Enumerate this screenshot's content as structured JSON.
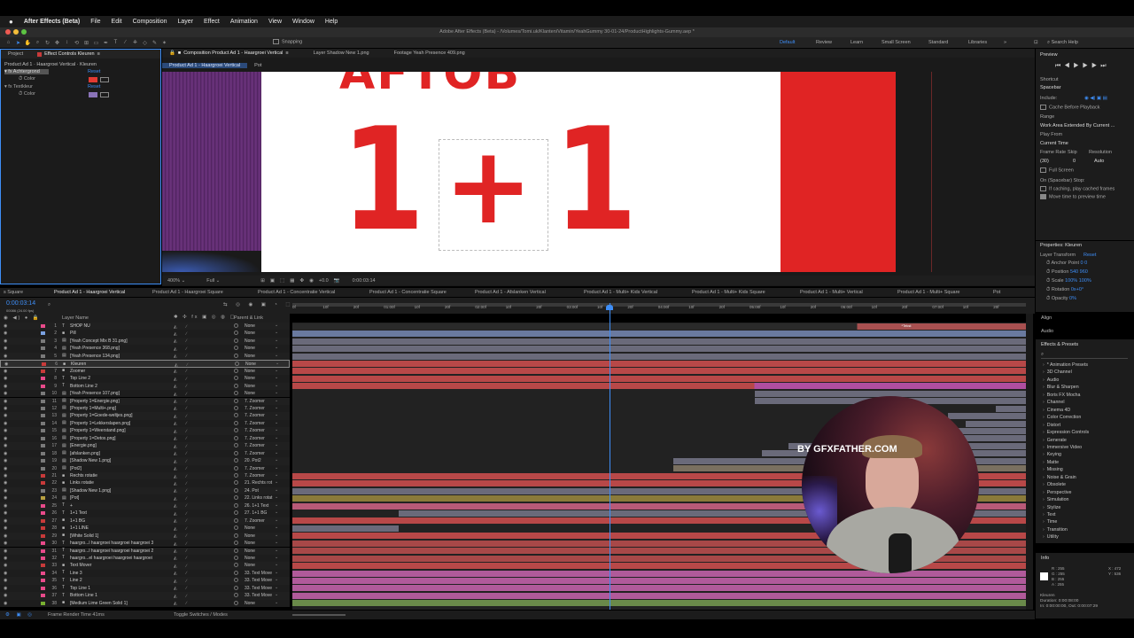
{
  "menubar": {
    "app": "After Effects (Beta)",
    "items": [
      "File",
      "Edit",
      "Composition",
      "Layer",
      "Effect",
      "Animation",
      "View",
      "Window",
      "Help"
    ]
  },
  "title": "Adobe After Effects (Beta) - /Volumes/Tomi.uk/Klanten/Vitamin/YeahGummy 30-01-24/ProductHighlights-Gummy.aep *",
  "toolbar": {
    "snapping": "Snapping",
    "workspaces": [
      "Default",
      "Review",
      "Learn",
      "Small Screen",
      "Standard",
      "Libraries"
    ],
    "search": "Search Help"
  },
  "project": {
    "tabs": [
      "Project",
      "Effect Controls Kleuren"
    ],
    "header": "Product Ad 1 · Haargroei Vertical · Kleuren",
    "effects": [
      {
        "name": "Achtergrond",
        "reset": "Reset",
        "prop": "Color",
        "color": "#e23a32"
      },
      {
        "name": "Textkleur",
        "reset": "Reset",
        "prop": "Color",
        "color": "#8a73b8"
      }
    ]
  },
  "viewer": {
    "tabs": [
      "Composition Product Ad 1 - Haargroei Vertical",
      "Layer Shadow New 1.png",
      "Footage Yeah Presence 409.png"
    ],
    "breadcrumb": [
      "Product Ad 1 - Haargroei Vertical",
      "Pot"
    ],
    "top_text": "AFTOB",
    "big_left": "1",
    "plus": "+",
    "big_right": "1",
    "zoom": "400%",
    "quality": "Full",
    "timecode": "0:00:03:14",
    "exposure": "+0.0"
  },
  "comp_tabs": [
    "s Square",
    "Product Ad 1 - Haargroei Vertical",
    "Product Ad 1 - Haargroei Square",
    "Product Ad 1 - Concentratie Vertical",
    "Product Ad 1 - Concentratie Square",
    "Product Ad 1 - Afslanken Vertical",
    "Product Ad 1 - Multi+ Kids Vertical",
    "Product Ad 1 - Multi+ Kids Square",
    "Product Ad 1 - Multi+ Vertical",
    "Product Ad 1 - Multi+ Square",
    "Pot"
  ],
  "timeline": {
    "timecode": "0:00:03:14",
    "frames": "00086 (24.00 fps)",
    "layer_name_header": "Layer Name",
    "parent_header": "Parent & Link",
    "ruler": [
      "0f",
      "10f",
      "20f",
      "01:00f",
      "10f",
      "20f",
      "02:00f",
      "10f",
      "20f",
      "03:00f",
      "10f",
      "20f",
      "04:00f",
      "10f",
      "20f",
      "05:00f",
      "10f",
      "20f",
      "06:00f",
      "10f",
      "20f",
      "07:00f",
      "10f",
      "20f"
    ],
    "marker": "*Tekst",
    "footer_left": "Frame Render Time 41ms",
    "footer_mid": "Toggle Switches / Modes"
  },
  "layers": [
    {
      "n": "1",
      "t": "T",
      "name": "SHOP NU",
      "parent": "None",
      "color": "#e84a8a"
    },
    {
      "n": "2",
      "t": "■",
      "name": "Pill",
      "parent": "None",
      "color": "#7aa0e0"
    },
    {
      "n": "3",
      "t": "▤",
      "name": "[Yeah Concept Mix B 31.png]",
      "parent": "None",
      "color": "#7a7a7a"
    },
    {
      "n": "4",
      "t": "▤",
      "name": "[Yeah Presence 368.png]",
      "parent": "None",
      "color": "#7a7a7a"
    },
    {
      "n": "5",
      "t": "▤",
      "name": "[Yeah Presence 134.png]",
      "parent": "None",
      "color": "#7a7a7a"
    },
    {
      "n": "6",
      "t": "■",
      "name": "Kleuren",
      "parent": "None",
      "color": "#c83a3a"
    },
    {
      "n": "7",
      "t": "■",
      "name": "Zoomer",
      "parent": "None",
      "color": "#c83a3a"
    },
    {
      "n": "8",
      "t": "T",
      "name": "Top Line 2",
      "parent": "None",
      "color": "#e84a8a"
    },
    {
      "n": "9",
      "t": "T",
      "name": "Bottom Line 2",
      "parent": "None",
      "color": "#e84a8a"
    },
    {
      "n": "10",
      "t": "▤",
      "name": "[Yeah Presence 107.png]",
      "parent": "None",
      "color": "#7a7a7a"
    },
    {
      "n": "11",
      "t": "▤",
      "name": "[Property 1=Energie.png]",
      "parent": "7. Zoomer",
      "color": "#7a7a7a"
    },
    {
      "n": "12",
      "t": "▤",
      "name": "[Property 1=Multi+.png]",
      "parent": "7. Zoomer",
      "color": "#7a7a7a"
    },
    {
      "n": "13",
      "t": "▤",
      "name": "[Property 1=Goede-weltjes.png]",
      "parent": "7. Zoomer",
      "color": "#7a7a7a"
    },
    {
      "n": "14",
      "t": "▤",
      "name": "[Property 1=Lekkerslapen.png]",
      "parent": "7. Zoomer",
      "color": "#7a7a7a"
    },
    {
      "n": "15",
      "t": "▤",
      "name": "[Property 1=Weerstand.png]",
      "parent": "7. Zoomer",
      "color": "#7a7a7a"
    },
    {
      "n": "16",
      "t": "▤",
      "name": "[Property 1=Detox.png]",
      "parent": "7. Zoomer",
      "color": "#7a7a7a"
    },
    {
      "n": "17",
      "t": "▤",
      "name": "[Energie.png]",
      "parent": "7. Zoomer",
      "color": "#7a7a7a"
    },
    {
      "n": "18",
      "t": "▤",
      "name": "[afslanken.png]",
      "parent": "7. Zoomer",
      "color": "#7a7a7a"
    },
    {
      "n": "19",
      "t": "▤",
      "name": "[Shadow New 1.png]",
      "parent": "20. Pot2",
      "color": "#7a7a7a"
    },
    {
      "n": "20",
      "t": "▤",
      "name": "[Pot2]",
      "parent": "7. Zoomer",
      "color": "#7a7a7a"
    },
    {
      "n": "21",
      "t": "■",
      "name": "Rechts rotatie",
      "parent": "7. Zoomer",
      "color": "#c83a3a"
    },
    {
      "n": "22",
      "t": "■",
      "name": "Links rotatie",
      "parent": "21. Rechts rot",
      "color": "#c83a3a"
    },
    {
      "n": "23",
      "t": "▤",
      "name": "[Shadow New 1.png]",
      "parent": "24. Pot",
      "color": "#7a7a7a"
    },
    {
      "n": "24",
      "t": "▤",
      "name": "[Pot]",
      "parent": "22. Links rotat",
      "color": "#b8a040"
    },
    {
      "n": "25",
      "t": "T",
      "name": "+",
      "parent": "26. 1+1 Text",
      "color": "#e84a8a"
    },
    {
      "n": "26",
      "t": "T",
      "name": "1+1 Text",
      "parent": "27. 1+1 BG",
      "color": "#e84a8a"
    },
    {
      "n": "27",
      "t": "■",
      "name": "1+1 BG",
      "parent": "7. Zoomer",
      "color": "#c83a3a"
    },
    {
      "n": "28",
      "t": "■",
      "name": "1+1 LINE",
      "parent": "None",
      "color": "#c83a3a"
    },
    {
      "n": "29",
      "t": "■",
      "name": "[White Solid 1]",
      "parent": "None",
      "color": "#c83a3a"
    },
    {
      "n": "30",
      "t": "T",
      "name": "haargro...l haargroei haargroei haargroei 3",
      "parent": "None",
      "color": "#e84a8a"
    },
    {
      "n": "31",
      "t": "T",
      "name": "haargro...l haargroei haargroei haargroei 2",
      "parent": "None",
      "color": "#e84a8a"
    },
    {
      "n": "32",
      "t": "T",
      "name": "haargro...el haargroei haargroei haargroei",
      "parent": "None",
      "color": "#e84a8a"
    },
    {
      "n": "33",
      "t": "■",
      "name": "Text Mover",
      "parent": "None",
      "color": "#c83a3a"
    },
    {
      "n": "34",
      "t": "T",
      "name": "Line 3",
      "parent": "33. Text Move",
      "color": "#e84a8a"
    },
    {
      "n": "35",
      "t": "T",
      "name": "Line 2",
      "parent": "33. Text Move",
      "color": "#e84a8a"
    },
    {
      "n": "36",
      "t": "T",
      "name": "Top Line 1",
      "parent": "33. Text Move",
      "color": "#e84a8a"
    },
    {
      "n": "37",
      "t": "T",
      "name": "Bottom Line 1",
      "parent": "33. Text Move",
      "color": "#e84a8a"
    },
    {
      "n": "38",
      "t": "■",
      "name": "[Medium Lime Green Solid 1]",
      "parent": "None",
      "color": "#78b030"
    }
  ],
  "preview": {
    "title": "Preview",
    "shortcut_label": "Shortcut",
    "shortcut": "Spacebar",
    "include": "Include:",
    "cache": "Cache Before Playback",
    "range_label": "Range",
    "range": "Work Area Extended By Current ...",
    "play_from_label": "Play From",
    "play_from": "Current Time",
    "frame_rate": "Frame Rate",
    "skip": "Skip",
    "resolution": "Resolution",
    "fr_val": "(30)",
    "skip_val": "0",
    "res_val": "Auto",
    "full_screen": "Full Screen",
    "stop_label": "On (Spacebar) Stop:",
    "stop1": "If caching, play cached frames",
    "stop2": "Move time to preview time"
  },
  "properties": {
    "title": "Properties: Kleuren",
    "transform": "Layer Transform",
    "reset": "Reset",
    "rows": [
      {
        "k": "Anchor Point",
        "v": "0     0"
      },
      {
        "k": "Position",
        "v": "540    960"
      },
      {
        "k": "Scale",
        "v": "100%    100%"
      },
      {
        "k": "Rotation",
        "v": "0x+0°"
      },
      {
        "k": "Opacity",
        "v": "0%"
      }
    ]
  },
  "align": "Align",
  "audio": "Audio",
  "effects_presets": {
    "title": "Effects & Presets",
    "items": [
      "* Animation Presets",
      "3D Channel",
      "Audio",
      "Blur & Sharpen",
      "Boris FX Mocha",
      "Channel",
      "Cinema 4D",
      "Color Correction",
      "Distort",
      "Expression Controls",
      "Generate",
      "Immersive Video",
      "Keying",
      "Matte",
      "Missing",
      "Noise & Grain",
      "Obsolete",
      "Perspective",
      "Simulation",
      "Stylize",
      "Text",
      "Time",
      "Transition",
      "Utility"
    ]
  },
  "info": {
    "title": "Info",
    "r": "R : 255",
    "g": "G : 255",
    "b": "B : 255",
    "a": "A : 255",
    "x": "X : 472",
    "y": "Y : 536",
    "name": "Kleuren",
    "duration": "Duration: 0:00:08:00",
    "inout": "In: 0:00:00:00, Out: 0:00:07:29"
  },
  "watermark": "BY GFXFATHER.COM"
}
